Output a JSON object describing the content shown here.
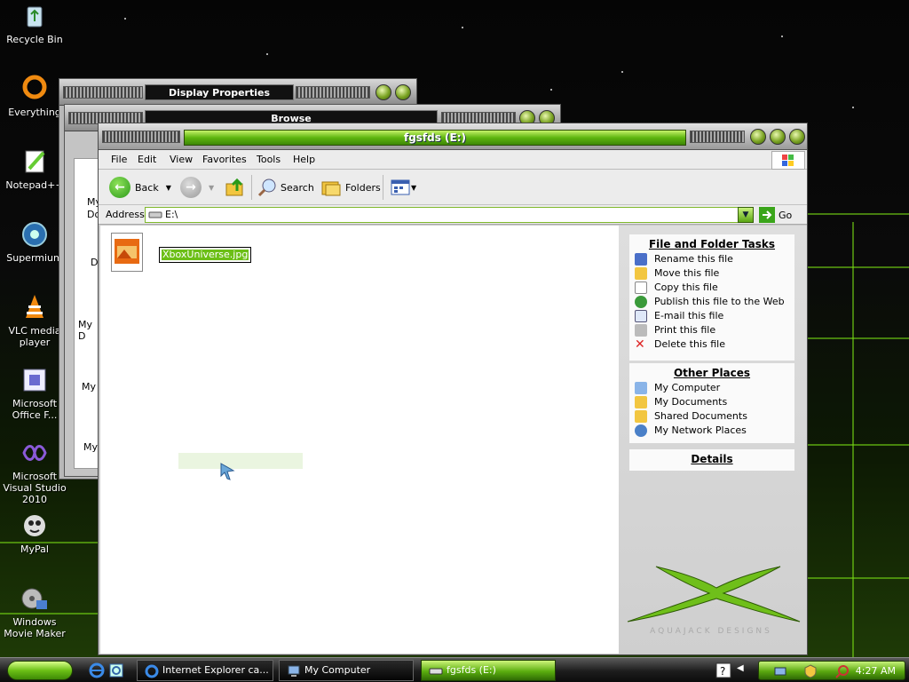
{
  "desktop": {
    "icons": [
      {
        "label": "Recycle Bin"
      },
      {
        "label": "Everything"
      },
      {
        "label": "Notepad++"
      },
      {
        "label": "Supermium"
      },
      {
        "label": "VLC media player"
      },
      {
        "label": "Microsoft Office F..."
      },
      {
        "label": "Microsoft Visual Studio 2010"
      },
      {
        "label": "MyPal"
      },
      {
        "label": "Windows Movie Maker"
      }
    ]
  },
  "back_windows": {
    "display_title": "Display Properties",
    "browse_title": "Browse",
    "browse_partial": [
      "My",
      "Do",
      "D",
      "My D",
      "My",
      "My"
    ]
  },
  "window": {
    "title": "fgsfds (E:)",
    "menu": [
      "File",
      "Edit",
      "View",
      "Favorites",
      "Tools",
      "Help"
    ],
    "toolbar": {
      "back": "Back",
      "search": "Search",
      "folders": "Folders"
    },
    "address": {
      "label": "Address",
      "value": "E:\\",
      "go": "Go"
    },
    "file": {
      "name": "XboxUniverse.jpg"
    },
    "tasks": {
      "file_folder": {
        "title": "File and Folder Tasks",
        "items": [
          "Rename this file",
          "Move this file",
          "Copy this file",
          "Publish this file to the Web",
          "E-mail this file",
          "Print this file",
          "Delete this file"
        ]
      },
      "other_places": {
        "title": "Other Places",
        "items": [
          "My Computer",
          "My Documents",
          "Shared Documents",
          "My Network Places"
        ]
      },
      "details": {
        "title": "Details"
      }
    },
    "watermark": "AQUAJACK DESIGNS"
  },
  "taskbar": {
    "buttons": [
      {
        "label": "Internet Explorer ca..."
      },
      {
        "label": "My Computer"
      },
      {
        "label": "fgsfds (E:)"
      }
    ],
    "clock": "4:27 AM"
  }
}
